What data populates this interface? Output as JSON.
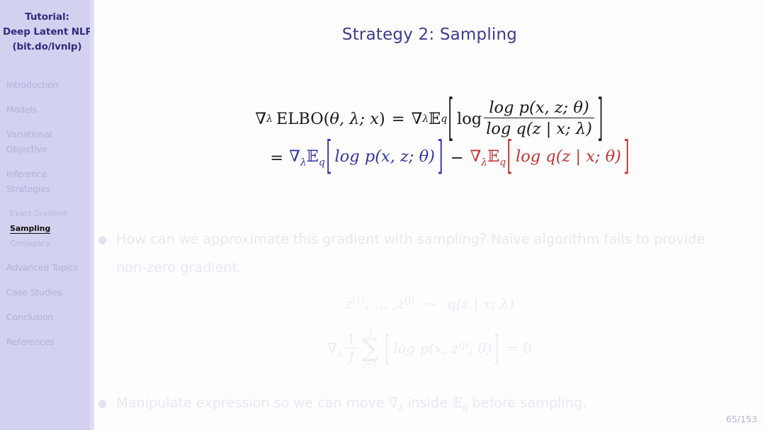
{
  "sidebar": {
    "title_lines": [
      "Tutorial:",
      "Deep Latent NLP",
      "(bit.do/lvnlp)"
    ],
    "bg_color": "#d2d1ef",
    "title_color": "#312e80",
    "items": [
      {
        "label": "Introduction"
      },
      {
        "label": "Models"
      },
      {
        "label": "Variational",
        "label2": "Objective"
      },
      {
        "label": "Inference",
        "label2": "Strategies"
      },
      {
        "label": "Advanced Topics"
      },
      {
        "label": "Case Studies"
      },
      {
        "label": "Conclusion"
      },
      {
        "label": "References"
      }
    ],
    "subitems": [
      {
        "label": "Exact Gradient",
        "active": false
      },
      {
        "label": "Sampling",
        "active": true
      },
      {
        "label": "Conjugacy",
        "active": false
      }
    ]
  },
  "slide": {
    "title": "Strategy 2: Sampling",
    "title_color": "#3d3c8e",
    "page_number": "65/153",
    "accent_blue": "#3434a8",
    "accent_red": "#c53232"
  },
  "equation": {
    "line1": {
      "lhs_nabla": "∇",
      "lhs_nabla_sub": "λ",
      "lhs_name": "ELBO(",
      "lhs_args": "θ, λ; x",
      "lhs_close": ")",
      "equals": "=",
      "rhs_nabla": "∇",
      "rhs_nabla_sub": "λ",
      "rhs_E": "𝔼",
      "rhs_E_sub": "q",
      "bracket_open": "[",
      "log": "log",
      "frac_num": "log p(x, z; θ)",
      "frac_den": "log q(z | x; λ)",
      "bracket_close": "]"
    },
    "line2": {
      "equals": "=",
      "term1": {
        "nabla": "∇",
        "nabla_sub": "λ",
        "E": "𝔼",
        "E_sub": "q",
        "bracket_open": "[",
        "content": "log p(x, z; θ)",
        "bracket_close": "]",
        "color": "#3434a8"
      },
      "minus": "−",
      "term2": {
        "nabla": "∇",
        "nabla_sub": "λ",
        "E": "𝔼",
        "E_sub": "q",
        "bracket_open": "[",
        "content": "log q(z | x; θ)",
        "bracket_close": "]",
        "color": "#c53232"
      }
    }
  },
  "body": {
    "bullet1": "How can we approximate this gradient with sampling? Naive algorithm fails to provide non-zero gradient.",
    "faded_eq1": {
      "z1": "z",
      "z1_sup": "(1)",
      "dots": ", … ,",
      "zJ": "z",
      "zJ_sup": "(J)",
      "sim": "∼",
      "rhs": "q(z | x; λ)"
    },
    "faded_eq2": {
      "nabla": "∇",
      "nabla_sub": "λ",
      "frac_num": "1",
      "frac_den": "J",
      "sum_upper": "J",
      "sum_sigma": "∑",
      "sum_lower": "j=1",
      "bracket_open": "[",
      "content": "log p(x, z",
      "content_sup": "(j)",
      "content_tail": "; θ)",
      "bracket_close": "]",
      "equals_zero": "= 0"
    },
    "bullet2_pre": "Manipulate expression so we can move",
    "bullet2_nabla": "∇",
    "bullet2_nabla_sub": "λ",
    "bullet2_mid": "inside",
    "bullet2_E": "𝔼",
    "bullet2_E_sub": "q",
    "bullet2_post": "before sampling."
  }
}
